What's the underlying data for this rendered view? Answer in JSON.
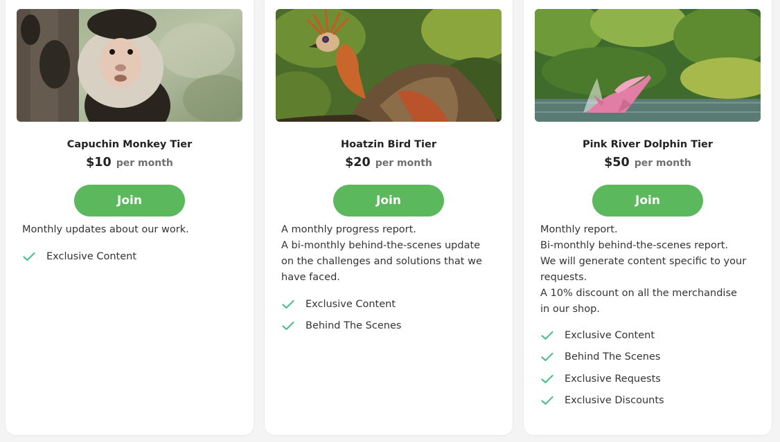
{
  "tiers": [
    {
      "name": "Capuchin Monkey Tier",
      "price": "$10",
      "period": "per month",
      "join_label": "Join",
      "description": "Monthly updates about our work.",
      "benefits": [
        "Exclusive Content"
      ]
    },
    {
      "name": "Hoatzin Bird Tier",
      "price": "$20",
      "period": "per month",
      "join_label": "Join",
      "description": "A monthly progress report.\nA bi-monthly behind-the-scenes update on the challenges and solutions that we have faced.",
      "benefits": [
        "Exclusive Content",
        "Behind The Scenes"
      ]
    },
    {
      "name": "Pink River Dolphin Tier",
      "price": "$50",
      "period": "per month",
      "join_label": "Join",
      "description": "Monthly report.\nBi-monthly behind-the-scenes report.\nWe will generate content specific to your requests.\nA 10% discount on all the merchandise in our shop.",
      "benefits": [
        "Exclusive Content",
        "Behind The Scenes",
        "Exclusive Requests",
        "Exclusive Discounts"
      ]
    }
  ],
  "icons": {
    "benefit": "check-icon"
  },
  "colors": {
    "join_button": "#5cb85c",
    "check": "#4fc08d"
  }
}
